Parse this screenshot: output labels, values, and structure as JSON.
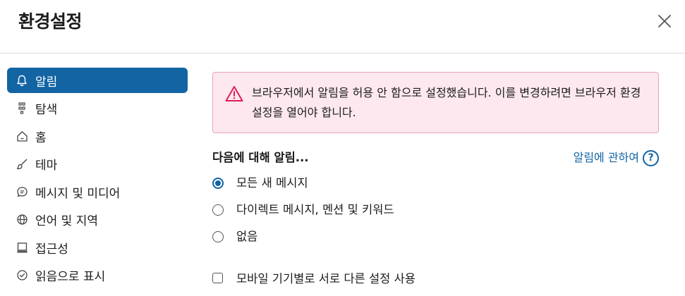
{
  "header": {
    "title": "환경설정"
  },
  "sidebar": {
    "items": [
      {
        "label": "알림",
        "icon": "bell-icon",
        "active": true
      },
      {
        "label": "탐색",
        "icon": "search-icon"
      },
      {
        "label": "홈",
        "icon": "home-icon"
      },
      {
        "label": "테마",
        "icon": "brush-icon"
      },
      {
        "label": "메시지 및 미디어",
        "icon": "message-icon"
      },
      {
        "label": "언어 및 지역",
        "icon": "globe-icon"
      },
      {
        "label": "접근성",
        "icon": "keyboard-icon"
      },
      {
        "label": "읽음으로 표시",
        "icon": "check-circle-icon"
      }
    ]
  },
  "alert": {
    "text": "브라우저에서 알림을 허용 안 함으로 설정했습니다. 이를 변경하려면 브라우저 환경설정을 열어야 합니다.",
    "icon": "warning-icon"
  },
  "notify": {
    "title": "다음에 대해 알림...",
    "learn_more": "알림에 관하여",
    "learn_icon": "?",
    "options": [
      {
        "label": "모든 새 메시지",
        "checked": true
      },
      {
        "label": "다이렉트 메시지, 멘션 및 키워드",
        "checked": false
      },
      {
        "label": "없음",
        "checked": false
      }
    ],
    "mobile_setting": "모바일 기기별로 서로 다른 설정 사용"
  },
  "colors": {
    "accent": "#1264a3",
    "alert_bg": "#fce8ee",
    "alert_border": "#e8a6b7",
    "warn": "#e01e5a"
  }
}
